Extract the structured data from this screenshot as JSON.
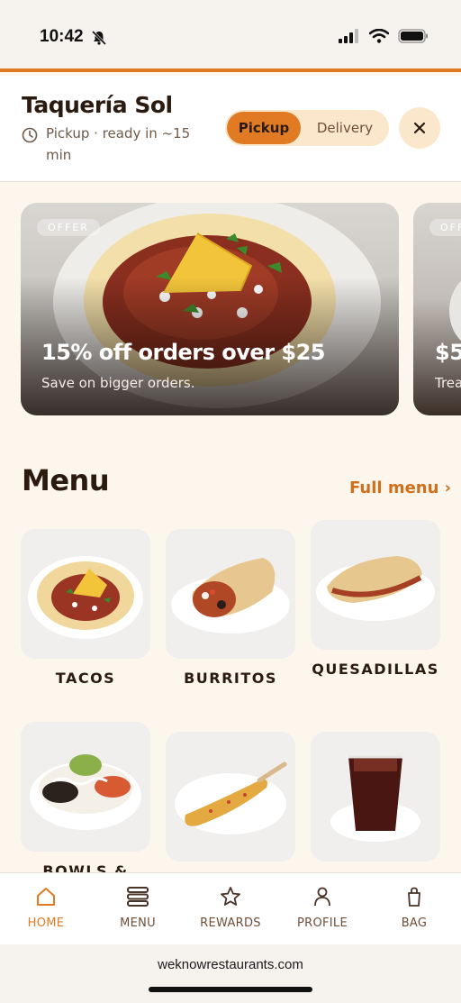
{
  "status_bar": {
    "time": "10:42"
  },
  "header": {
    "restaurant_name": "Taquería Sol",
    "pickup_status": "Pickup · ready in ~15 min",
    "modes": [
      "Pickup",
      "Delivery"
    ],
    "active_mode": "Pickup"
  },
  "offers": [
    {
      "badge": "OFFER",
      "title": "15% off orders over $25",
      "subtitle": "Save on bigger orders."
    },
    {
      "badge": "OFFER",
      "title": "$5",
      "subtitle": "Trea"
    }
  ],
  "menu": {
    "title": "Menu",
    "full_menu_link": "Full menu ›",
    "categories": [
      {
        "label": "TACOS",
        "icon": "taco-photo"
      },
      {
        "label": "BURRITOS",
        "icon": "burrito-photo"
      },
      {
        "label": "QUESADILLAS",
        "icon": "quesadilla-photo"
      },
      {
        "label": "BOWLS &",
        "icon": "bowl-photo"
      },
      {
        "label": "",
        "icon": "elote-photo"
      },
      {
        "label": "",
        "icon": "drink-photo"
      }
    ]
  },
  "tabbar": {
    "items": [
      {
        "label": "HOME",
        "icon": "home-icon",
        "active": true
      },
      {
        "label": "MENU",
        "icon": "menu-icon",
        "active": false
      },
      {
        "label": "REWARDS",
        "icon": "star-icon",
        "active": false
      },
      {
        "label": "PROFILE",
        "icon": "person-icon",
        "active": false
      },
      {
        "label": "BAG",
        "icon": "bag-icon",
        "active": false
      }
    ]
  },
  "browser": {
    "url": "weknowrestaurants.com"
  },
  "colors": {
    "accent": "#e07b24",
    "background": "#fdf6ec",
    "text": "#2a1a10"
  }
}
